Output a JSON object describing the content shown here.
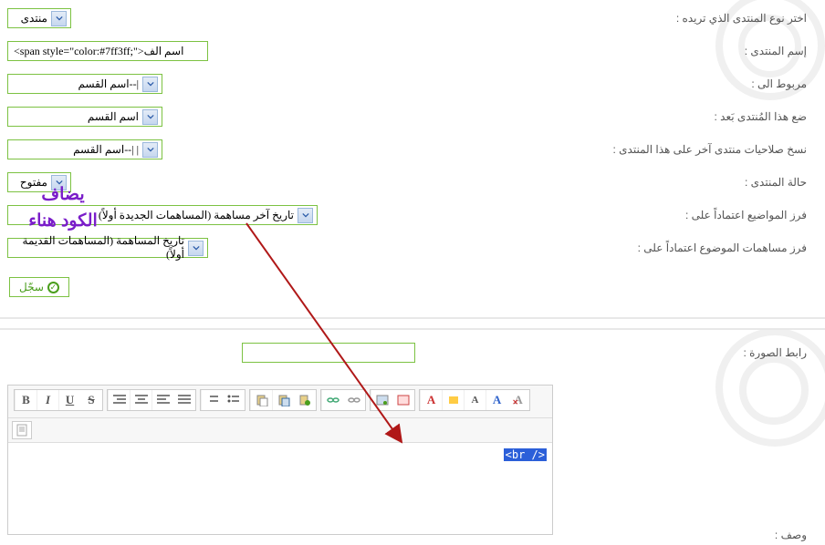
{
  "labels": {
    "forum_type": "اختر نوع المنتدى الذي تريده :",
    "forum_name": "إسم المنتدى :",
    "linked_to": "مربوط الى :",
    "place_after": "ضع هذا المُنتدى بَعد :",
    "copy_perms": "نسخ صلاحيات منتدى آخر على هذا المنتدى :",
    "forum_state": "حالة المنتدى :",
    "sort_topics": "فرز المواضيع اعتماداً على :",
    "sort_posts": "فرز مساهمات الموضوع اعتماداً على :",
    "image_link": "رابط الصورة :",
    "description": "وصف :"
  },
  "values": {
    "forum_type": "منتدى",
    "forum_name": "<span style=\"color:#7ff3ff;\">اسم الف",
    "linked_to": "|--اسم القسم",
    "place_after": "اسم القسم",
    "copy_perms": "|   |--اسم القسم",
    "forum_state": "مفتوح",
    "sort_topics": "تاريخ آخر مساهمة (المساهمات الجديدة أولاً)",
    "sort_posts": "تاريخ المساهمة (المساهمات القديمة أولاً)",
    "image_link": ""
  },
  "submit": "سجّل",
  "annotation_line1": "يضاف",
  "annotation_line2": "الكود هناء",
  "editor_code": "<br /&gt;",
  "editor_code_display": "<br />",
  "toolbar": {
    "bold": "B",
    "italic": "I",
    "underline": "U",
    "strike": "S"
  }
}
